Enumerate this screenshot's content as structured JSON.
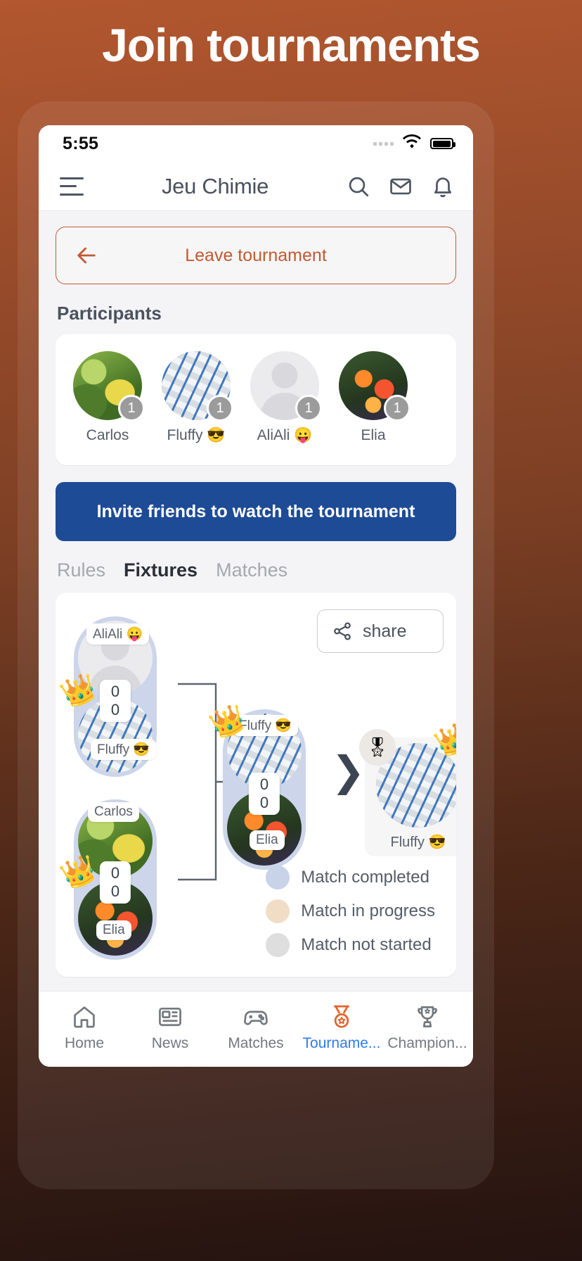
{
  "promo": {
    "headline": "Join tournaments"
  },
  "status_bar": {
    "time": "5:55",
    "signal_icon": "signal-dots-icon",
    "wifi_icon": "wifi-icon",
    "battery_icon": "battery-icon"
  },
  "app_bar": {
    "menu_icon": "hamburger-menu-icon",
    "title": "Jeu Chimie",
    "search_icon": "search-icon",
    "mail_icon": "mail-icon",
    "bell_icon": "bell-icon"
  },
  "leave": {
    "label": "Leave tournament",
    "arrow_icon": "arrow-left-icon",
    "accent": "#c25a33"
  },
  "participants": {
    "title": "Participants",
    "items": [
      {
        "name": "Carlos",
        "badge": "1",
        "avatar": "leaf-photo"
      },
      {
        "name": "Fluffy 😎",
        "badge": "1",
        "avatar": "tech-collage-photo"
      },
      {
        "name": "AliAli 😛",
        "badge": "1",
        "avatar": "default-person"
      },
      {
        "name": "Elia",
        "badge": "1",
        "avatar": "flower-photo"
      }
    ]
  },
  "invite": {
    "label": "Invite friends to watch the tournament",
    "color": "#1e4b96"
  },
  "tabs": [
    {
      "label": "Rules",
      "active": false
    },
    {
      "label": "Fixtures",
      "active": true
    },
    {
      "label": "Matches",
      "active": false
    }
  ],
  "bracket": {
    "share": {
      "label": "share",
      "icon": "share-icon"
    },
    "round1": [
      {
        "top": {
          "name": "AliAli 😛",
          "score": "0",
          "avatar": "default-person",
          "winner": false
        },
        "bottom": {
          "name": "Fluffy 😎",
          "score": "0",
          "avatar": "tech-collage-photo",
          "winner": true
        },
        "status": "completed"
      },
      {
        "top": {
          "name": "Carlos",
          "score": "0",
          "avatar": "leaf-photo",
          "winner": false
        },
        "bottom": {
          "name": "Elia",
          "score": "0",
          "avatar": "flower-photo",
          "winner": true
        },
        "status": "completed"
      }
    ],
    "round2": [
      {
        "top": {
          "name": "Fluffy 😎",
          "score": "0",
          "avatar": "tech-collage-photo",
          "winner": true
        },
        "bottom": {
          "name": "Elia",
          "score": "0",
          "avatar": "flower-photo",
          "winner": false
        },
        "status": "completed"
      }
    ],
    "champion": {
      "name": "Fluffy 😎",
      "avatar": "tech-collage-photo",
      "medal_icon": "medal-icon",
      "crown_icon": "crown-icon",
      "chevron_icon": "chevron-right-icon"
    },
    "legend": [
      {
        "label": "Match completed",
        "color": "#c8d2e9"
      },
      {
        "label": "Match in progress",
        "color": "#f1ddc6"
      },
      {
        "label": "Match not started",
        "color": "#dedede"
      }
    ]
  },
  "bottom_nav": [
    {
      "label": "Home",
      "icon": "home-icon",
      "active": false
    },
    {
      "label": "News",
      "icon": "news-icon",
      "active": false
    },
    {
      "label": "Matches",
      "icon": "gamepad-icon",
      "active": false
    },
    {
      "label": "Tourname...",
      "icon": "medal-icon",
      "active": true
    },
    {
      "label": "Champion...",
      "icon": "trophy-icon",
      "active": false
    }
  ]
}
